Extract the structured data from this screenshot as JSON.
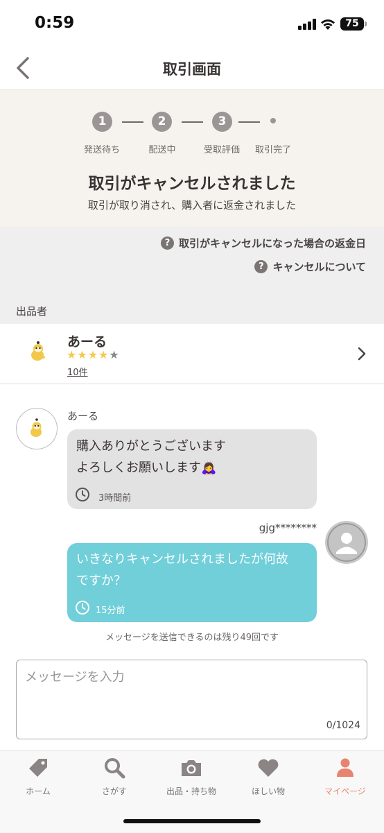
{
  "status_bar": {
    "time": "0:59",
    "battery": "75"
  },
  "header": {
    "title": "取引画面"
  },
  "progress": {
    "steps": [
      {
        "number": "1",
        "label": "発送待ち"
      },
      {
        "number": "2",
        "label": "配送中"
      },
      {
        "number": "3",
        "label": "受取評価"
      },
      {
        "number": "",
        "label": "取引完了"
      }
    ],
    "title": "取引がキャンセルされました",
    "subtitle": "取引が取り消され、購入者に返金されました"
  },
  "help_links": [
    {
      "label": "取引がキャンセルになった場合の返金日"
    },
    {
      "label": "キャンセルについて"
    }
  ],
  "seller": {
    "section_label": "出品者",
    "name": "あーる",
    "rating_stars": 4,
    "rating_max": 5,
    "review_count": "10件"
  },
  "messages": [
    {
      "sender": "あーる",
      "text_line1": "購入ありがとうございます",
      "text_line2": "よろしくお願いします🙇‍♀️",
      "time": "3時間前",
      "side": "left"
    },
    {
      "sender": "gjg********",
      "text_line1": "いきなりキャンセルされましたが何故",
      "text_line2": "ですか？",
      "time": "15分前",
      "side": "right"
    }
  ],
  "remaining_notice": "メッセージを送信できるのは残り49回です",
  "message_input": {
    "placeholder": "メッセージを入力",
    "value": "",
    "char_count": "0/1024"
  },
  "tab_bar": {
    "items": [
      {
        "label": "ホーム",
        "icon": "tag-icon"
      },
      {
        "label": "さがす",
        "icon": "search-icon"
      },
      {
        "label": "出品・持ち物",
        "icon": "camera-icon"
      },
      {
        "label": "ほしい物",
        "icon": "heart-icon"
      },
      {
        "label": "マイページ",
        "icon": "person-icon"
      }
    ],
    "active_index": 4
  },
  "colors": {
    "accent": "#e8836f",
    "my_bubble": "#70cfd9",
    "their_bubble": "#e3e2e3",
    "step": "#9c9595"
  }
}
